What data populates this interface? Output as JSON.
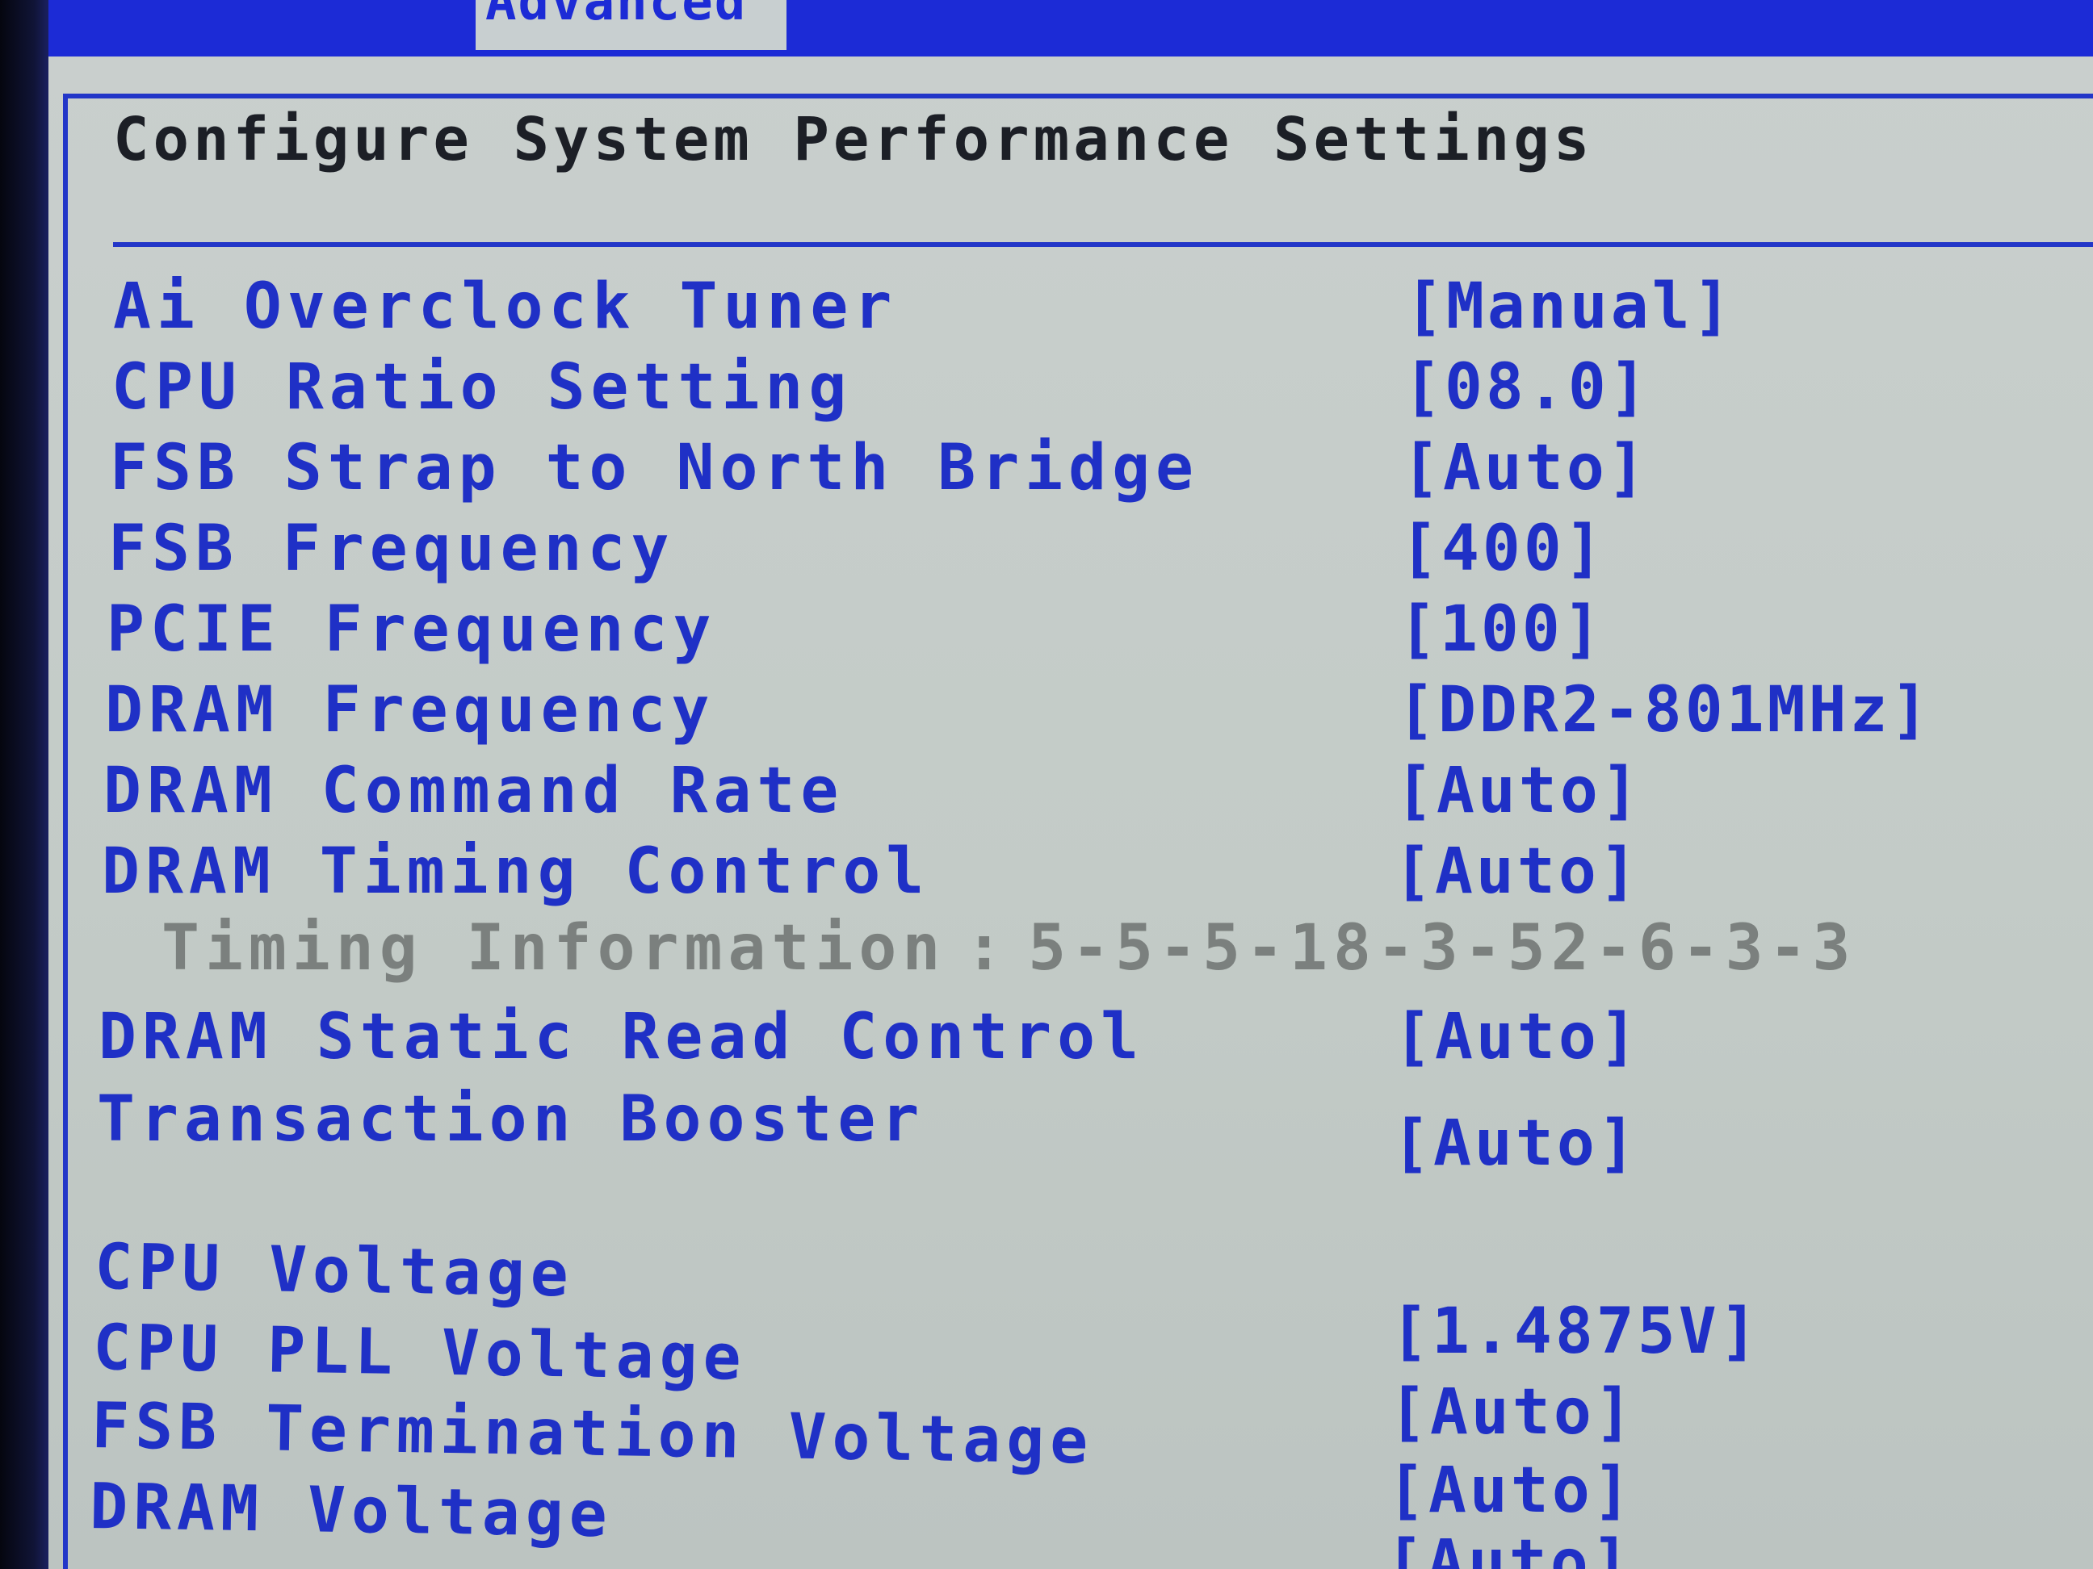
{
  "header": {
    "active_tab": "Advanced"
  },
  "panel": {
    "title": "Configure System Performance Settings"
  },
  "settings": [
    {
      "label": "Ai Overclock Tuner",
      "value": "[Manual]"
    },
    {
      "label": "CPU Ratio Setting",
      "value": "[08.0]"
    },
    {
      "label": "FSB Strap to North Bridge",
      "value": "[Auto]"
    },
    {
      "label": "FSB Frequency",
      "value": "[400]"
    },
    {
      "label": "PCIE Frequency",
      "value": "[100]"
    },
    {
      "label": "DRAM Frequency",
      "value": "[DDR2-801MHz]"
    },
    {
      "label": "DRAM Command Rate",
      "value": "[Auto]"
    },
    {
      "label": "DRAM Timing Control",
      "value": "[Auto]"
    },
    {
      "label": "DRAM Static Read Control",
      "value": "[Auto]"
    },
    {
      "label": "Transaction Booster",
      "value": "[Auto]"
    },
    {
      "label": "CPU Voltage",
      "value": "[1.4875V]"
    },
    {
      "label": "CPU PLL Voltage",
      "value": "[Auto]"
    },
    {
      "label": "FSB Termination Voltage",
      "value": "[Auto]"
    },
    {
      "label": "DRAM Voltage",
      "value": "[Auto]"
    }
  ],
  "timing_information": {
    "label": "Timing Information",
    "separator": ":",
    "value": "5-5-5-18-3-52-6-3-3"
  },
  "colors": {
    "bios_blue": "#1f30c6",
    "screen_gray": "#c6cdcb",
    "info_gray": "#7b807e"
  }
}
